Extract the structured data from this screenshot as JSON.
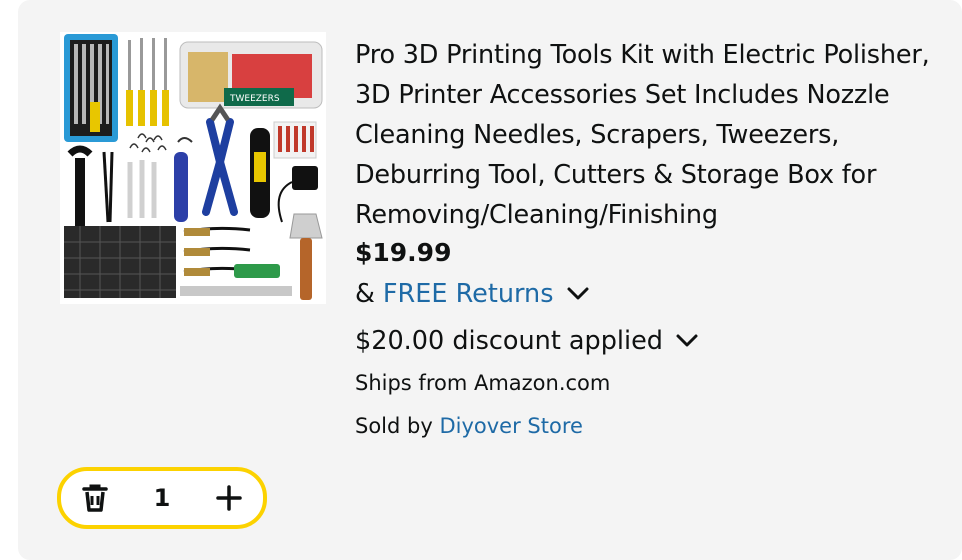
{
  "product": {
    "title": "Pro 3D Printing Tools Kit with Electric Polisher, 3D Printer Accessories Set Includes Nozzle Cleaning Needles, Scrapers, Tweezers, Deburring Tool, Cutters & Storage Box for Removing/Cleaning/Finishing",
    "price": "$19.99",
    "returns_prefix": "&",
    "returns_link": "FREE Returns",
    "discount": "$20.00 discount applied",
    "ships_from": "Ships from Amazon.com",
    "sold_by_prefix": "Sold by",
    "seller": "Diyover Store",
    "image_label": "TWEEZERS"
  },
  "quantity": {
    "value": "1",
    "delete_icon": "trash-icon",
    "add_icon": "plus-icon"
  },
  "colors": {
    "link": "#1e6aa6",
    "highlight": "#fcd200"
  }
}
